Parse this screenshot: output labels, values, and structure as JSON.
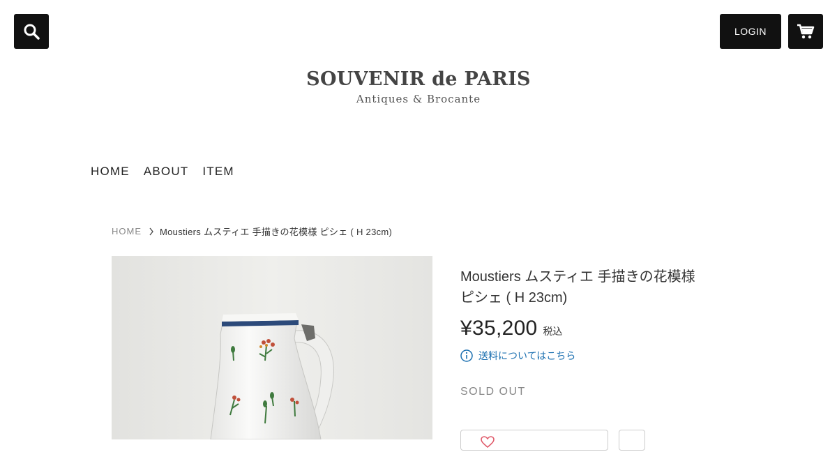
{
  "header": {
    "login_label": "LOGIN",
    "search_icon": "search-icon",
    "cart_icon": "cart-icon"
  },
  "logo": {
    "title": "SOUVENIR de PARIS",
    "subtitle": "Antiques & Brocante"
  },
  "nav": {
    "items": [
      {
        "label": "HOME"
      },
      {
        "label": "ABOUT"
      },
      {
        "label": "ITEM"
      }
    ]
  },
  "breadcrumb": {
    "home": "HOME",
    "current": "Moustiers ムスティエ 手描きの花模様 ピシェ ( H 23cm)"
  },
  "product": {
    "title_line1": "Moustiers ムスティエ 手描きの花模様",
    "title_line2": "ピシェ ( H 23cm)",
    "price": "¥35,200",
    "tax_label": "税込",
    "shipping_link": "送料についてはこちら",
    "status": "SOLD OUT",
    "image_alt": "white faience pitcher with hand-painted flowers"
  },
  "colors": {
    "header_button": "#111111",
    "link": "#1a6fb0",
    "heart": "#e05a6a"
  }
}
